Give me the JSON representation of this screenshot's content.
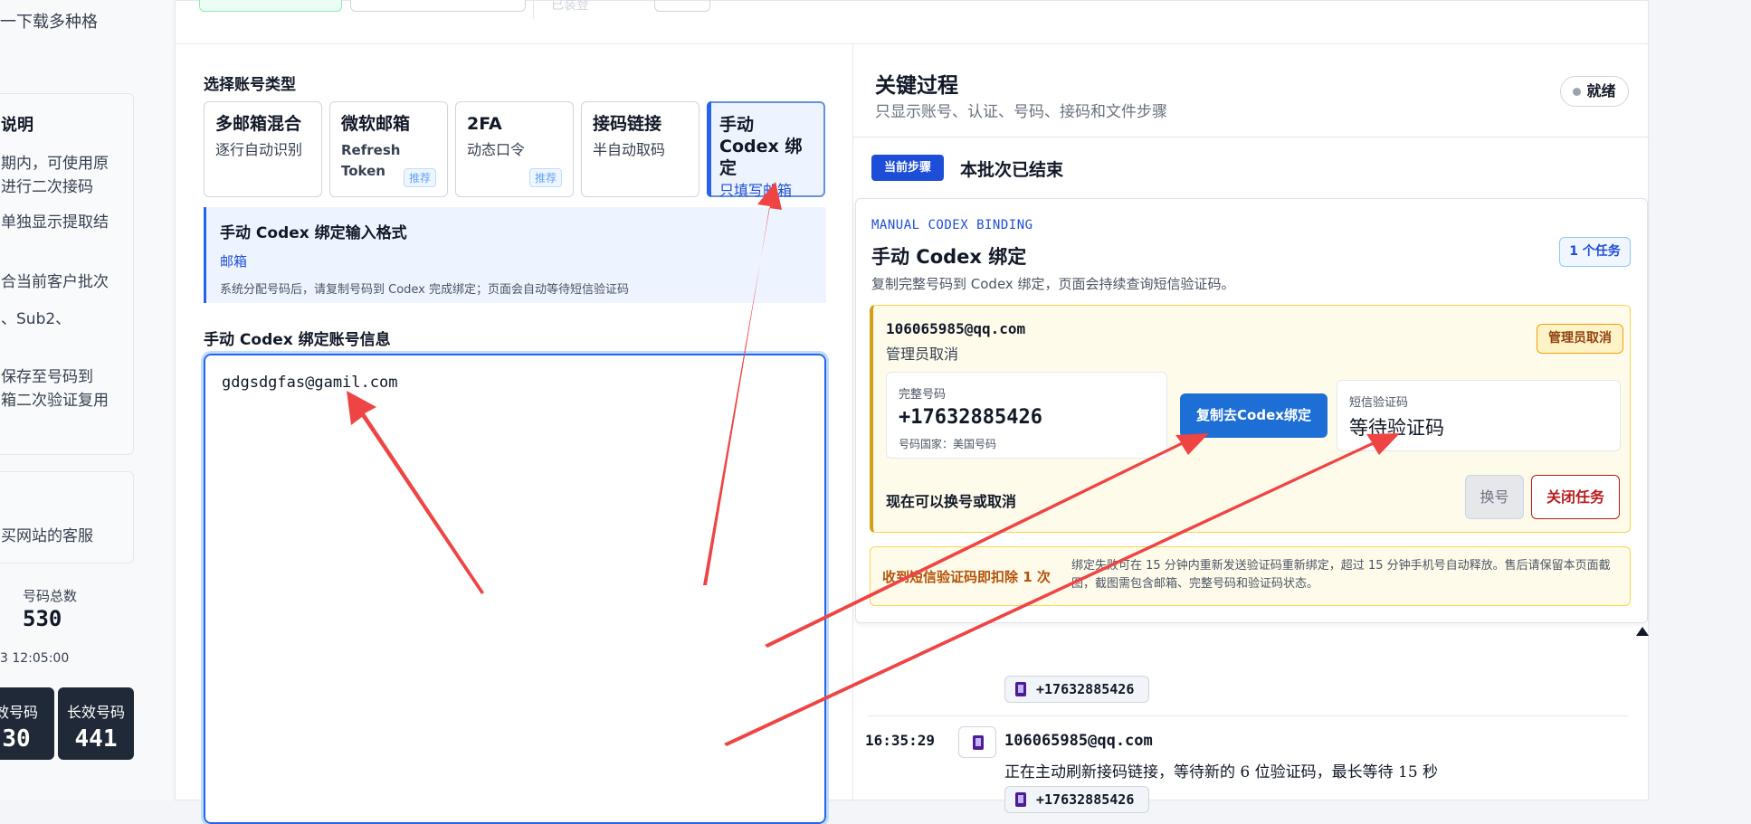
{
  "sidebar": {
    "top_text": "一下载多种格",
    "card1_title": "说明",
    "card1_lines": [
      "期内，可使用原",
      "进行二次接码",
      "单独显示提取结",
      "合当前客户批次",
      "、Sub2、",
      "保存至号码到",
      "箱二次验证复用"
    ],
    "card2_text": "买网站的客服",
    "count_label": "号码总数",
    "count_value": "530",
    "time": "3 12:05:00",
    "tile1_label": "效号码",
    "tile1_value": "30",
    "tile2_label": "长效号码",
    "tile2_value": "441"
  },
  "topbar": {
    "faded_label": "已装登"
  },
  "account_types": {
    "section_title": "选择账号类型",
    "items": [
      {
        "name": "多邮箱混合",
        "desc": "逐行自动识别",
        "badge": ""
      },
      {
        "name": "微软邮箱",
        "desc": "Refresh Token",
        "badge": "推荐"
      },
      {
        "name": "2FA",
        "desc": "动态口令",
        "badge": "推荐"
      },
      {
        "name": "接码链接",
        "desc": "半自动取码",
        "badge": ""
      },
      {
        "name": "手动 Codex 绑定",
        "desc": "只填写邮箱",
        "badge": ""
      }
    ]
  },
  "format": {
    "title": "手动 Codex 绑定输入格式",
    "example": "邮箱",
    "hint": "系统分配号码后，请复制号码到 Codex 完成绑定；页面会自动等待短信验证码"
  },
  "input": {
    "title": "手动 Codex 绑定账号信息",
    "value": "gdgsdgfas@gamil.com"
  },
  "process": {
    "title": "关键过程",
    "subtitle": "只显示账号、认证、号码、接码和文件步骤",
    "status": "就绪",
    "current_step_tag": "当前步骤",
    "current_step_text": "本批次已结束"
  },
  "binding": {
    "tag": "MANUAL CODEX BINDING",
    "title": "手动 Codex 绑定",
    "subtitle": "复制完整号码到 Codex 绑定，页面会持续查询短信验证码。",
    "task_count": "1 个任务",
    "task": {
      "email": "106065985@qq.com",
      "status": "管理员取消",
      "badge": "管理员取消",
      "number_label": "完整号码",
      "number": "+17632885426",
      "country": "号码国家：美国号码",
      "copy_button": "复制去Codex绑定",
      "sms_label": "短信验证码",
      "sms_value": "等待验证码",
      "can_text": "现在可以换号或取消",
      "swap_button": "换号",
      "close_button": "关闭任务"
    },
    "notice_title": "收到短信验证码即扣除 1 次",
    "notice_text": "绑定失败可在 15 分钟内重新发送验证码重新绑定，超过 15 分钟手机号自动释放。售后请保留本页面截图，截图需包含邮箱、完整号码和验证码状态。"
  },
  "log": {
    "pill1": "+17632885426",
    "time": "16:35:29",
    "email": "106065985@qq.com",
    "message": "正在主动刷新接码链接，等待新的 6 位验证码，最长等待 15 秒",
    "pill2": "+17632885426"
  },
  "colors": {
    "accent": "#1d4ed8",
    "annotation_arrow": "#ef4444",
    "warning": "#f59e0b"
  }
}
